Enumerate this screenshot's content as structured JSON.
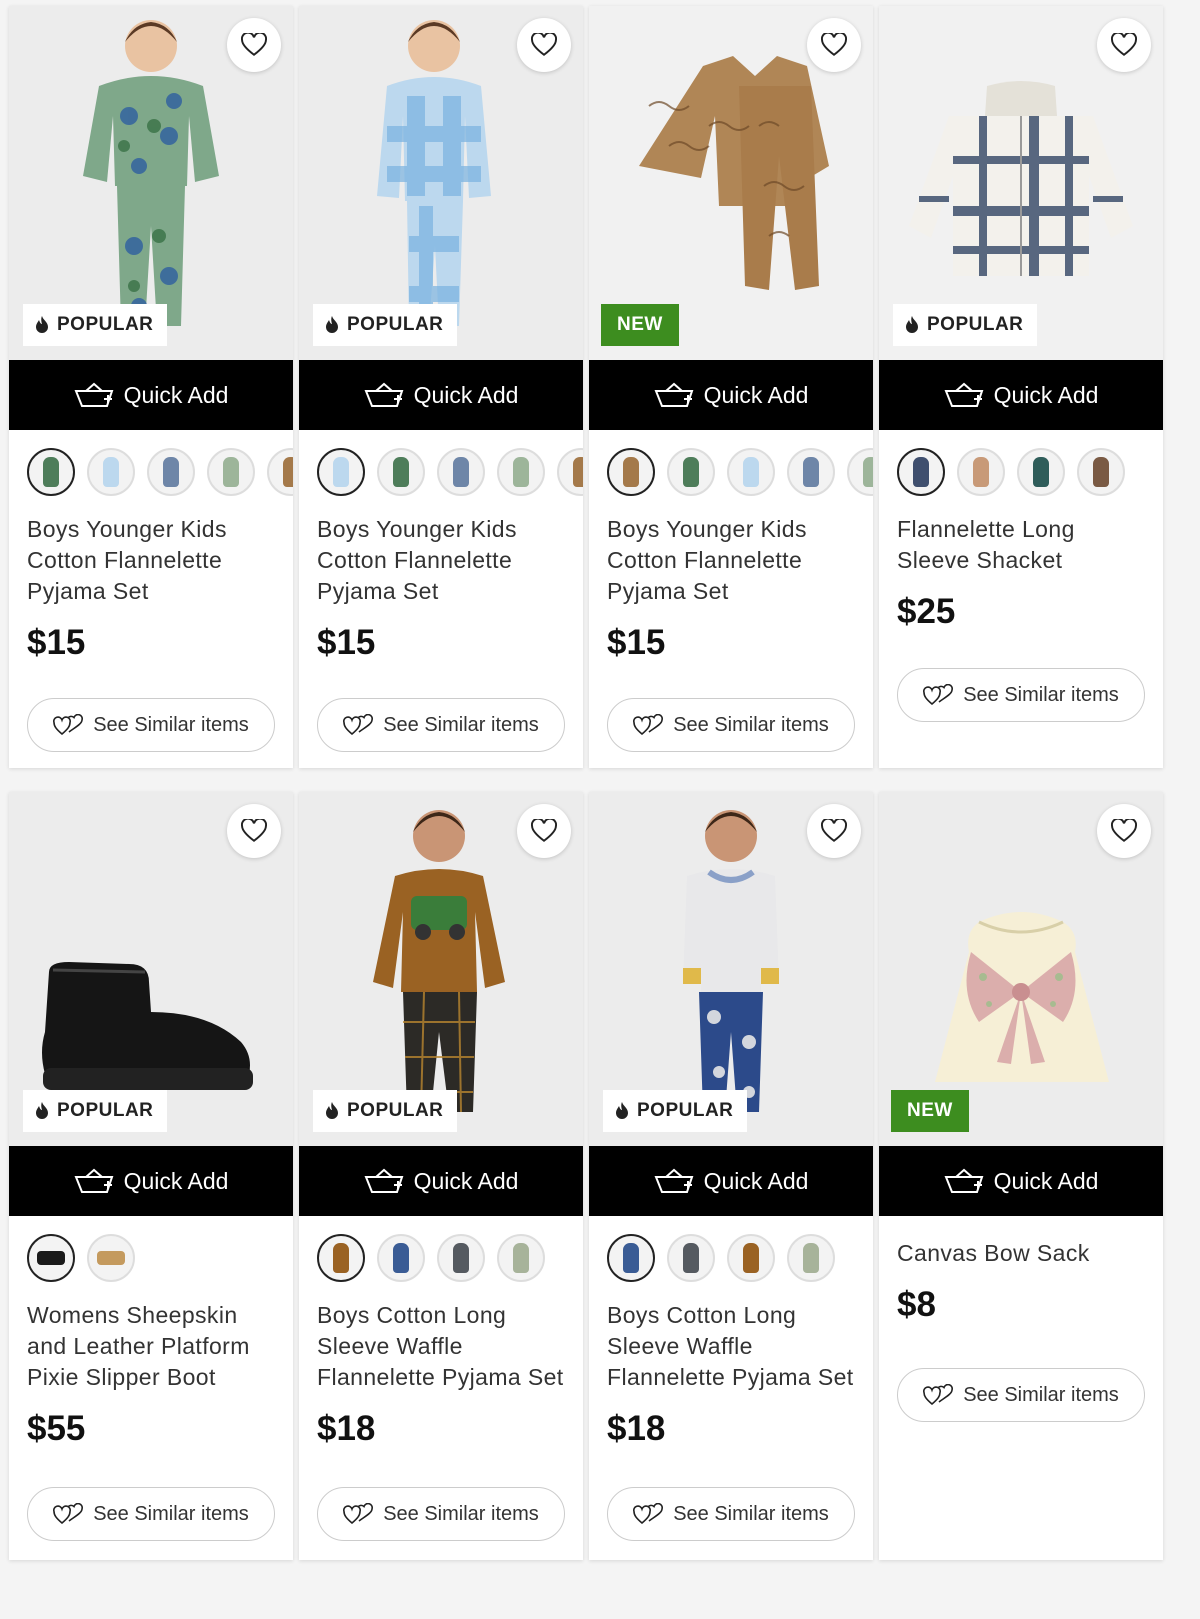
{
  "labels": {
    "quick_add": "Quick Add",
    "see_similar": "See Similar items",
    "popular": "POPULAR",
    "new": "NEW"
  },
  "colors": {
    "new_badge": "#3d8d1f",
    "quick_add_bg": "#000000"
  },
  "products": [
    {
      "name": "Boys Younger Kids Cotton Flannelette Pyjama Set",
      "price": "$15",
      "badge": "POPULAR",
      "swatches": [
        "#4e7d5a",
        "#bcd8ee",
        "#6e86a8",
        "#9db59a",
        "#a4794a"
      ]
    },
    {
      "name": "Boys Younger Kids Cotton Flannelette Pyjama Set",
      "price": "$15",
      "badge": "POPULAR",
      "swatches": [
        "#bcd8ee",
        "#4e7d5a",
        "#6e86a8",
        "#9db59a",
        "#a4794a"
      ]
    },
    {
      "name": "Boys Younger Kids Cotton Flannelette Pyjama Set",
      "price": "$15",
      "badge": "NEW",
      "swatches": [
        "#a4794a",
        "#4e7d5a",
        "#bcd8ee",
        "#6e86a8",
        "#9db59a"
      ]
    },
    {
      "name": "Flannelette Long Sleeve Shacket",
      "price": "$25",
      "badge": "POPULAR",
      "swatches": [
        "#3f4f6e",
        "#c89a78",
        "#2f5d5a",
        "#7a5a44"
      ]
    },
    {
      "name": "Womens Sheepskin and Leather Platform Pixie Slipper Boot",
      "price": "$55",
      "badge": "POPULAR",
      "swatches": [
        "#1a1a1a",
        "#c49a5e"
      ]
    },
    {
      "name": "Boys Cotton Long Sleeve Waffle Flannelette Pyjama Set",
      "price": "$18",
      "badge": "POPULAR",
      "swatches": [
        "#9a6223",
        "#3a5c95",
        "#555a60",
        "#a7b39a"
      ]
    },
    {
      "name": "Boys Cotton Long Sleeve Waffle Flannelette Pyjama Set",
      "price": "$18",
      "badge": "POPULAR",
      "swatches": [
        "#3a5c95",
        "#555a60",
        "#9a6223",
        "#a7b39a"
      ]
    },
    {
      "name": "Canvas Bow Sack",
      "price": "$8",
      "badge": "NEW",
      "swatches": []
    }
  ]
}
